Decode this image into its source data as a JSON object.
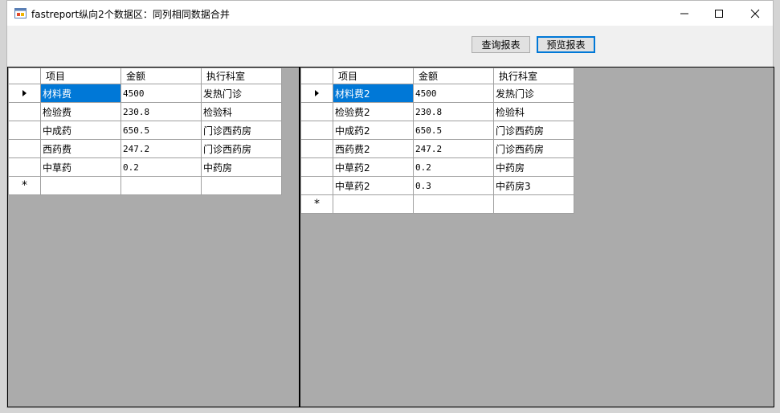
{
  "window": {
    "title": "fastreport纵向2个数据区：同列相同数据合并"
  },
  "toolbar": {
    "query_button": "查询报表",
    "preview_button": "预览报表"
  },
  "grid_left": {
    "columns": [
      "项目",
      "金额",
      "执行科室"
    ],
    "rows": [
      [
        "材料费",
        "4500",
        "发热门诊"
      ],
      [
        "检验费",
        "230.8",
        "检验科"
      ],
      [
        "中成药",
        "650.5",
        "门诊西药房"
      ],
      [
        "西药费",
        "247.2",
        "门诊西药房"
      ],
      [
        "中草药",
        "0.2",
        "中药房"
      ]
    ]
  },
  "grid_right": {
    "columns": [
      "项目",
      "金额",
      "执行科室"
    ],
    "rows": [
      [
        "材料费2",
        "4500",
        "发热门诊"
      ],
      [
        "检验费2",
        "230.8",
        "检验科"
      ],
      [
        "中成药2",
        "650.5",
        "门诊西药房"
      ],
      [
        "西药费2",
        "247.2",
        "门诊西药房"
      ],
      [
        "中草药2",
        "0.2",
        "中药房"
      ],
      [
        "中草药2",
        "0.3",
        "中药房3"
      ]
    ]
  },
  "new_row_marker": "*"
}
